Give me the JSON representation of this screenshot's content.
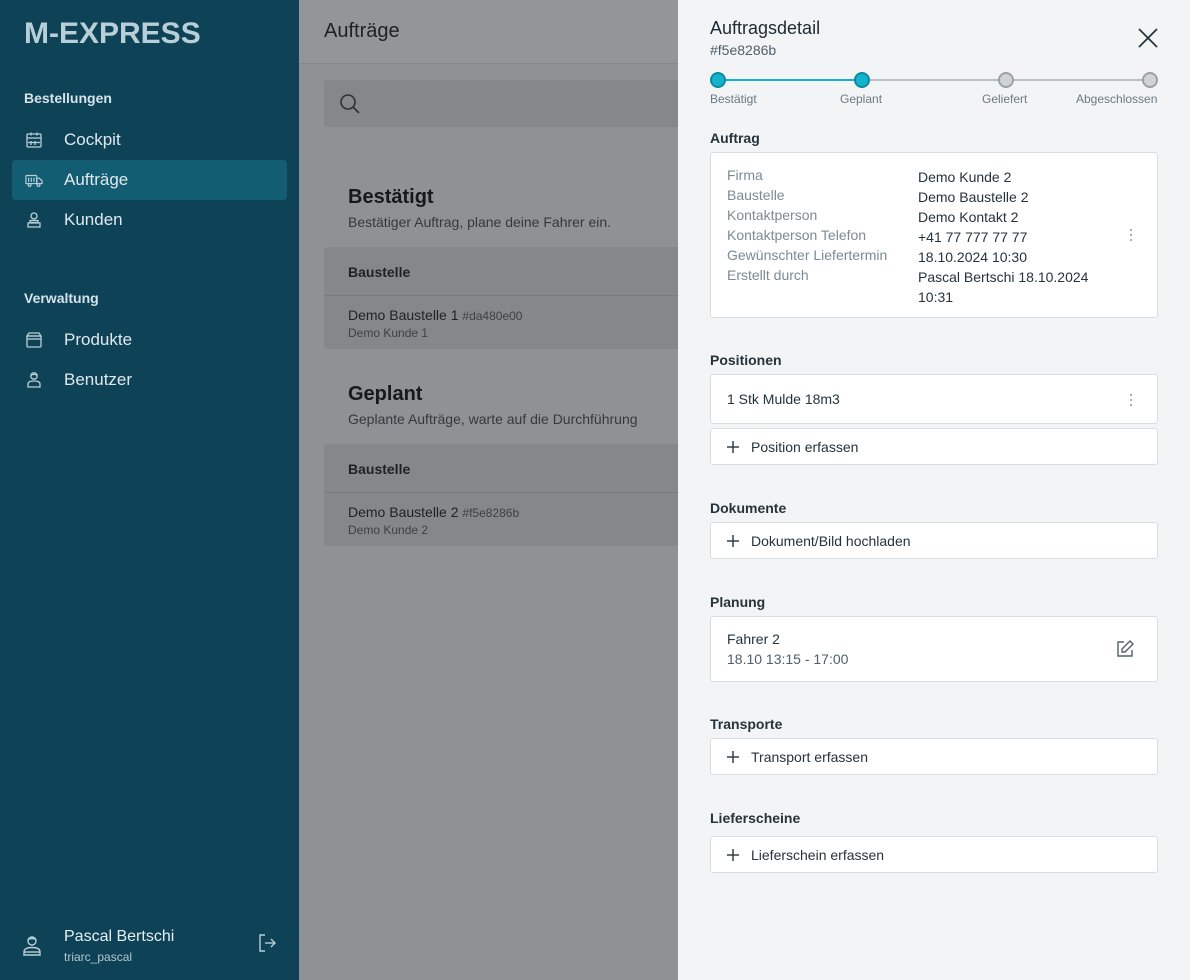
{
  "sidebar": {
    "logo_text": "M-EXPRESS",
    "sections": [
      {
        "title": "Bestellungen",
        "items": [
          {
            "label": "Cockpit",
            "icon": "calendar-icon"
          },
          {
            "label": "Aufträge",
            "icon": "truck-icon",
            "active": true
          },
          {
            "label": "Kunden",
            "icon": "person-icon"
          }
        ]
      },
      {
        "title": "Verwaltung",
        "items": [
          {
            "label": "Produkte",
            "icon": "box-icon"
          },
          {
            "label": "Benutzer",
            "icon": "user-icon"
          }
        ]
      }
    ],
    "user": {
      "name": "Pascal Bertschi",
      "handle": "triarc_pascal"
    }
  },
  "main": {
    "title": "Aufträge",
    "groups": [
      {
        "title": "Bestätigt",
        "subtitle": "Bestätiger Auftrag, plane deine Fahrer ein.",
        "column": "Baustelle",
        "row": {
          "title": "Demo Baustelle 1",
          "hash": "#da480e00",
          "customer": "Demo Kunde 1"
        }
      },
      {
        "title": "Geplant",
        "subtitle": "Geplante Aufträge, warte auf die Durchführung",
        "column": "Baustelle",
        "row": {
          "title": "Demo Baustelle 2",
          "hash": "#f5e8286b",
          "customer": "Demo Kunde 2"
        }
      }
    ]
  },
  "drawer": {
    "title": "Auftragsdetail",
    "id": "#f5e8286b",
    "steps": [
      {
        "label": "Bestätigt",
        "done": true
      },
      {
        "label": "Geplant",
        "done": true
      },
      {
        "label": "Geliefert",
        "done": false
      },
      {
        "label": "Abgeschlossen",
        "done": false
      }
    ],
    "auftrag": {
      "title": "Auftrag",
      "fields": [
        {
          "key": "Firma",
          "value": "Demo Kunde 2"
        },
        {
          "key": "Baustelle",
          "value": "Demo Baustelle 2"
        },
        {
          "key": "Kontaktperson",
          "value": "Demo Kontakt 2"
        },
        {
          "key": "Kontaktperson Telefon",
          "value": "+41 77 777 77 77"
        },
        {
          "key": "Gewünschter Liefertermin",
          "value": "18.10.2024 10:30"
        },
        {
          "key": "Erstellt durch",
          "value": "Pascal Bertschi 18.10.2024 10:31"
        }
      ]
    },
    "positionen": {
      "title": "Positionen",
      "item": "1 Stk Mulde 18m3",
      "add_label": "Position erfassen"
    },
    "dokumente": {
      "title": "Dokumente",
      "add_label": "Dokument/Bild hochladen"
    },
    "planung": {
      "title": "Planung",
      "driver": "Fahrer 2",
      "time": "18.10 13:15 - 17:00"
    },
    "transporte": {
      "title": "Transporte",
      "add_label": "Transport erfassen"
    },
    "lieferscheine": {
      "title": "Lieferscheine",
      "add_label": "Lieferschein erfassen"
    }
  }
}
